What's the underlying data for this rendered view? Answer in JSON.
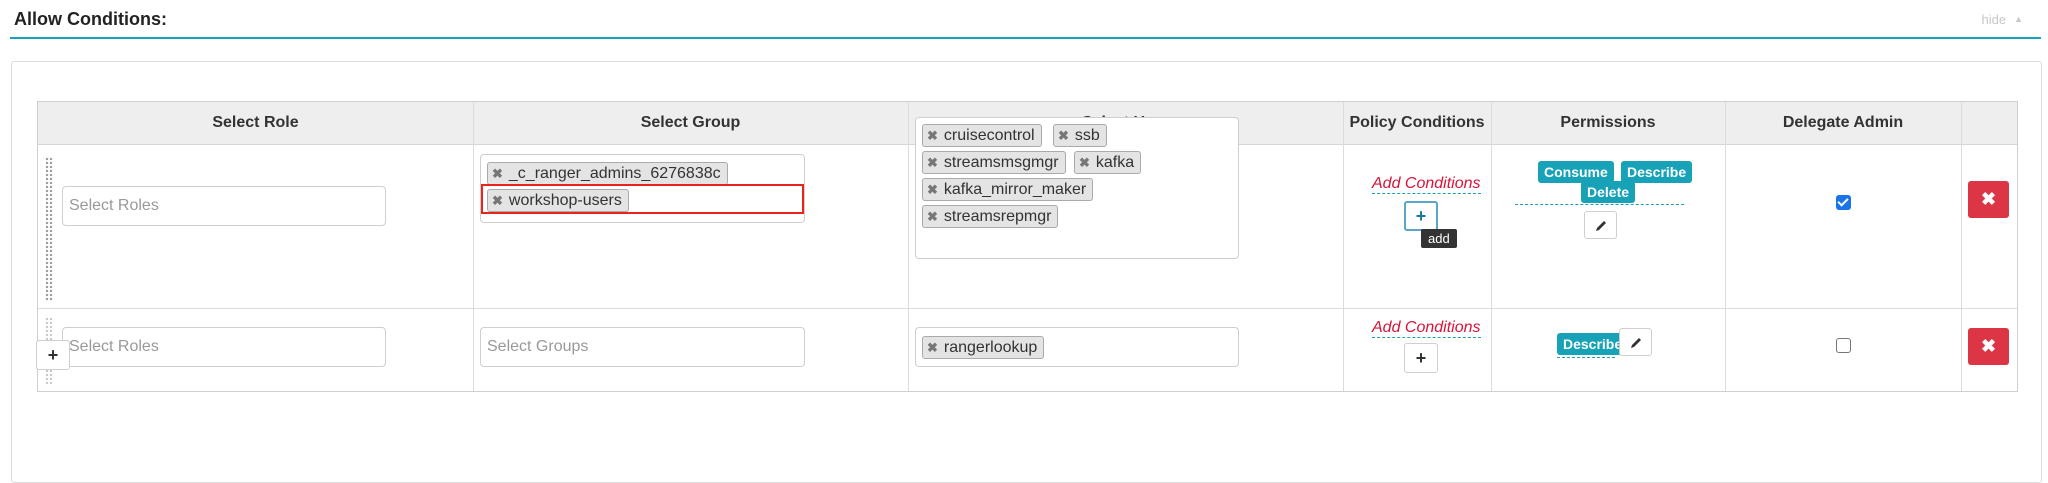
{
  "section": {
    "title": "Allow Conditions:",
    "toggle_label": "hide",
    "toggle_icon": "caret-up-icon"
  },
  "columns": [
    "Select Role",
    "Select Group",
    "Select User",
    "Policy Conditions",
    "Permissions",
    "Delegate Admin",
    ""
  ],
  "rows": [
    {
      "role_placeholder": "Select Roles",
      "groups": [
        "_c_ranger_admins_6276838c",
        "workshop-users"
      ],
      "group_placeholder": "",
      "users": [
        "cruisecontrol",
        "ssb",
        "streamsmsgmgr",
        "kafka",
        "kafka_mirror_maker",
        "streamsrepmgr"
      ],
      "add_conditions_label": "Add Conditions",
      "add_tooltip": "add",
      "permissions": [
        "Consume",
        "Describe",
        "Delete"
      ],
      "delegate_admin": true
    },
    {
      "role_placeholder": "Select Roles",
      "groups": [],
      "group_placeholder": "Select Groups",
      "users": [
        "rangerlookup"
      ],
      "add_conditions_label": "Add Conditions",
      "permissions": [
        "Describe"
      ],
      "delegate_admin": false
    }
  ],
  "colors": {
    "accent": "#17a2b8",
    "danger": "#dc3545",
    "highlight": "#e8251a",
    "conditions_link": "#d7143a"
  },
  "icons": {
    "remove_tag": "x-icon",
    "add": "plus-icon",
    "edit": "pencil-icon",
    "delete_row": "close-icon",
    "drag": "drag-handle-icon"
  }
}
